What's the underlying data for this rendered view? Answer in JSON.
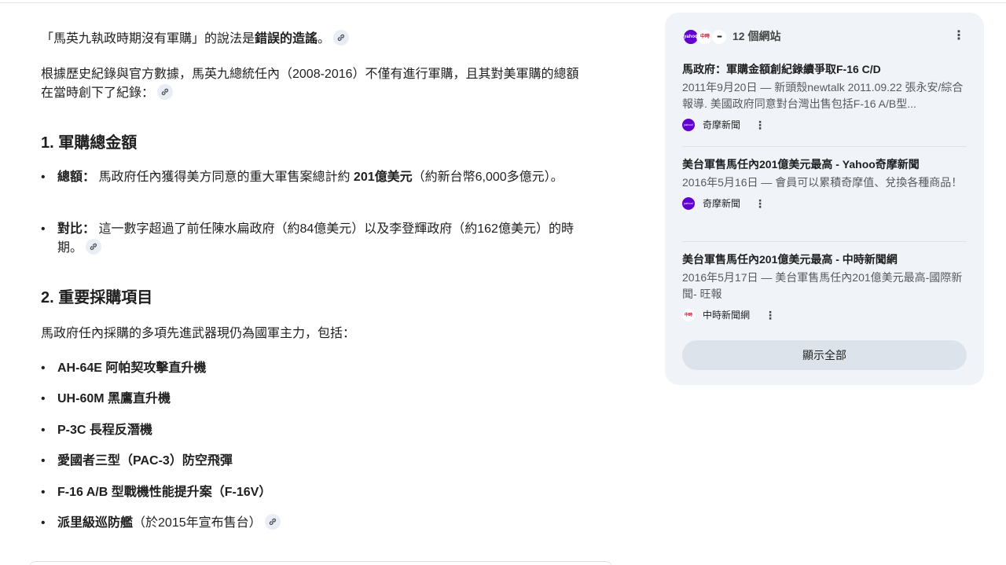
{
  "answer": {
    "intro": {
      "prefix": "「馬英九執政時期沒有軍購」的說法是",
      "bold": "錯誤的造謠",
      "suffix": "。"
    },
    "summary": "根據歷史紀錄與官方數據，馬英九總統任內（2008-2016）不僅有進行軍購，且其對美軍購的總額在當時創下了紀錄：",
    "section1": {
      "heading": "1. 軍購總金額",
      "bullets": [
        {
          "label": "總額：",
          "text_a": " 馬政府任內獲得美方同意的重大軍售案總計約 ",
          "bold": "201億美元",
          "text_b": "（約新台幣6,000多億元）。"
        },
        {
          "label": "對比：",
          "text_a": " 這一數字超過了前任陳水扁政府（約84億美元）以及李登輝政府（約162億美元）的時期。"
        }
      ]
    },
    "section2": {
      "heading": "2. 重要採購項目",
      "intro": "馬政府任內採購的多項先進武器現仍為國軍主力，包括：",
      "items": [
        "AH-64E 阿帕契攻擊直升機",
        "UH-60M 黑鷹直升機",
        "P-3C 長程反潛機",
        "愛國者三型（PAC-3）防空飛彈",
        "F-16 A/B 型戰機性能提升案（F-16V）",
        "派里級巡防艦"
      ],
      "last_note": "（於2015年宣布售台）"
    }
  },
  "sources": {
    "count_label": "12 個網站",
    "cards": [
      {
        "title": "馬政府：軍購金額創紀錄續爭取F-16 C/D",
        "snippet": "2011年9月20日 — 新頭殼newtalk 2011.09.22 張永安/綜合報導. 美國政府同意對台灣出售包括F-16 A/B型...",
        "source": "奇摩新聞"
      },
      {
        "title": "美台軍售馬任內201億美元最高 - Yahoo奇摩新聞",
        "snippet": "2016年5月16日 — 會員可以累積奇摩值、兌換各種商品！",
        "source": "奇摩新聞"
      },
      {
        "title": "美台軍售馬任內201億美元最高 - 中時新聞網",
        "snippet": "2016年5月17日 — 美台軍售馬任內201億美元最高-國際新聞- 旺報",
        "source": "中時新聞網"
      }
    ],
    "show_all_label": "顯示全部",
    "favicon_labels": [
      "yahoo!",
      "中時",
      "▪▪▪"
    ]
  },
  "colors": {
    "panel_bg": "#f0f4f9",
    "yahoo_purple": "#6001d2",
    "chinatimes_red": "#c8102e",
    "button_bg": "#dde3ea"
  }
}
